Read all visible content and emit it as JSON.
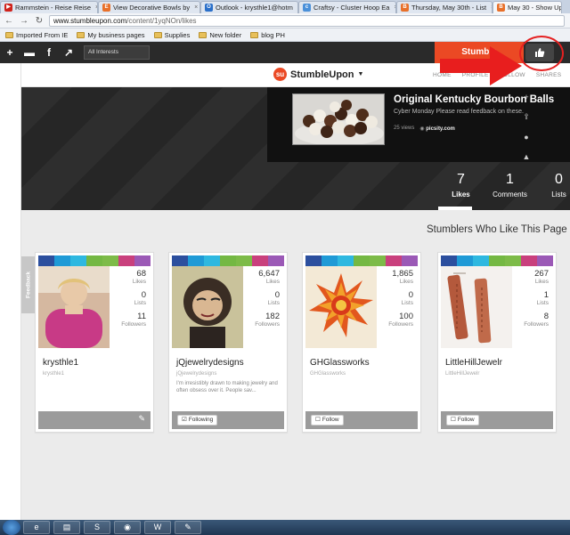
{
  "browser": {
    "tabs": [
      {
        "label": "Rammstein - Reise Reise",
        "icon_color": "#d0221b"
      },
      {
        "label": "View Decorative Bowls by",
        "icon_color": "#e8702a"
      },
      {
        "label": "Outlook - krysthle1@hotm",
        "icon_color": "#2a6fc9"
      },
      {
        "label": "Craftsy - Cluster Hoop Ea",
        "icon_color": "#4a90d9"
      },
      {
        "label": "Thursday, May 30th - List",
        "icon_color": "#e8702a"
      },
      {
        "label": "May 30 - Show Up",
        "icon_color": "#e8702a"
      }
    ],
    "url_domain": "www.stumbleupon.com",
    "url_path": "/content/1yqNOn/likes",
    "bookmarks": [
      "Imported From IE",
      "My business pages",
      "Supplies",
      "New folder",
      "blog PH"
    ]
  },
  "toolbar": {
    "interests_label": "All Interests",
    "stumble_label": "Stumble",
    "like_icon": "thumbs-up-icon"
  },
  "site": {
    "logo_text": "StumbleUpon",
    "nav": [
      "HOME",
      "PROFILE",
      "FOLLOW",
      "SHARES"
    ]
  },
  "page": {
    "title": "Original Kentucky Bourbon Balls",
    "subtitle": "Cyber Monday Please read feedback on these.",
    "views": "25 views",
    "source": "picsity.com",
    "stats": [
      {
        "value": "7",
        "label": "Likes"
      },
      {
        "value": "1",
        "label": "Comments"
      },
      {
        "value": "0",
        "label": "Lists"
      }
    ]
  },
  "section_title": "Stumblers Who Like This Page",
  "feedback_label": "Feedback",
  "stripe_colors": [
    "#2c4f9e",
    "#1f9ad6",
    "#2eb8e0",
    "#74b843",
    "#7dbb48",
    "#c9407d",
    "#9b59b6"
  ],
  "users": [
    {
      "name": "krysthle1",
      "handle": "krysthle1",
      "bio": "",
      "likes": "68",
      "lists": "0",
      "followers": "11",
      "follow_label": "",
      "owner": true
    },
    {
      "name": "jQjewelrydesigns",
      "handle": "jQjewelrydesigns",
      "bio": "I'm irresistibly drawn to making jewelry and often obsess over it. People sav...",
      "likes": "6,647",
      "lists": "0",
      "followers": "182",
      "follow_label": "Following",
      "owner": false
    },
    {
      "name": "GHGlassworks",
      "handle": "GHGlassworks",
      "bio": "",
      "likes": "1,865",
      "lists": "0",
      "followers": "100",
      "follow_label": "Follow",
      "owner": false
    },
    {
      "name": "LittleHillJewelr",
      "handle": "LittleHillJewelr",
      "bio": "",
      "likes": "267",
      "lists": "1",
      "followers": "8",
      "follow_label": "Follow",
      "owner": false
    }
  ],
  "stat_labels": {
    "likes": "Likes",
    "lists": "Lists",
    "followers": "Followers"
  },
  "taskbar": [
    "ie-icon",
    "explorer-icon",
    "skype-icon",
    "chrome-icon",
    "word-icon",
    "paint-icon"
  ]
}
